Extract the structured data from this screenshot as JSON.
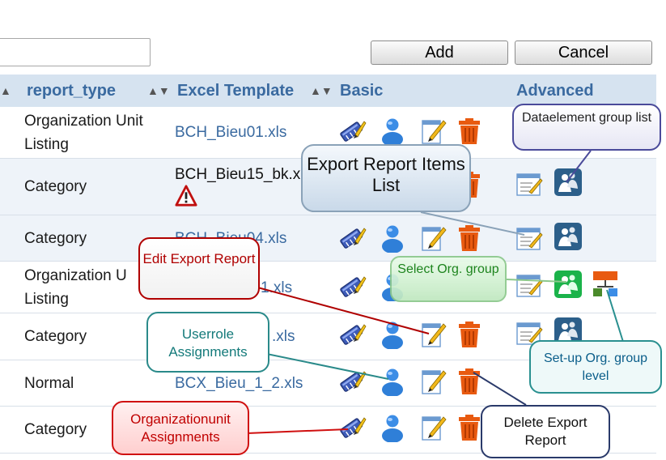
{
  "toolbar": {
    "add_label": "Add",
    "cancel_label": "Cancel",
    "search_value": ""
  },
  "table": {
    "headers": {
      "report_type": "report_type",
      "excel_template": "Excel Template",
      "basic": "Basic",
      "advanced": "Advanced"
    },
    "rows": [
      {
        "type_line1": "Organization Unit",
        "type_line2": "Listing",
        "template": "BCH_Bieu01.xls"
      },
      {
        "type_line1": "Category",
        "template": "BCH_Bieu15_bk.xls"
      },
      {
        "type_line1": "Category",
        "template": "BCH_Bieu04.xls"
      },
      {
        "type_line1": "Organization U",
        "type_line2": "Listing",
        "template": "1.xls"
      },
      {
        "type_line1": "Category",
        "template": ".xls"
      },
      {
        "type_line1": "Normal",
        "template": "BCX_Bieu_1_2.xls"
      },
      {
        "type_line1": "Category",
        "template": ""
      }
    ]
  },
  "callouts": {
    "edit_export_report": "Edit Export Report",
    "userrole_assignments": "Userrole Assignments",
    "organizationunit_assignments": "Organizationunit Assignments",
    "export_report_items_list": "Export Report Items List",
    "dataelement_group_list": "Dataelement group list",
    "select_org_group": "Select Org. group",
    "setup_org_group_level": "Set-up Org. group level",
    "delete_export_report": "Delete Export Report"
  },
  "icons": [
    "orgunit-assign-icon",
    "userrole-icon",
    "edit-icon",
    "delete-trash-icon",
    "items-list-icon",
    "dataelement-group-icon",
    "select-org-group-icon",
    "org-group-level-icon",
    "warning-icon"
  ],
  "colors": {
    "header_bg": "#d6e3f0",
    "header_text": "#3a6aa0",
    "link": "#3a6aa0",
    "alt_row": "#eef3f9"
  }
}
